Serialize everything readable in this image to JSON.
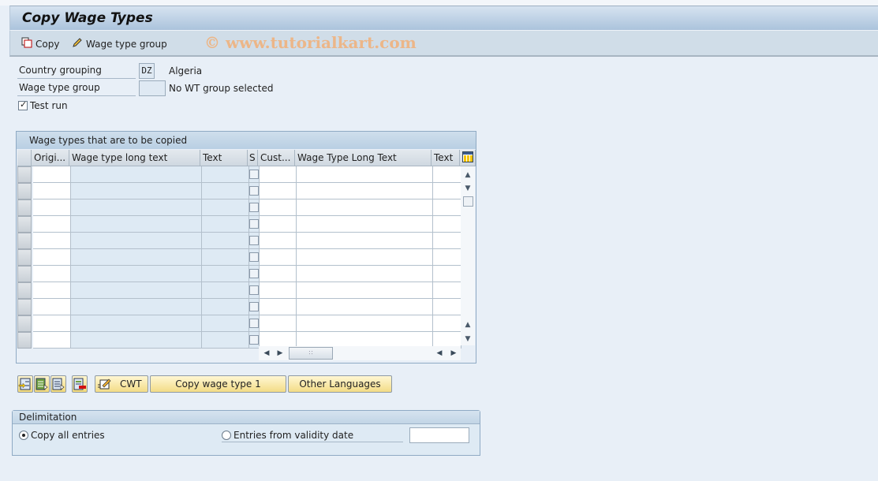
{
  "window": {
    "title": "Copy Wage Types"
  },
  "toolbar": {
    "copy_label": "Copy",
    "copy_icon": "copy-icon",
    "wage_type_group_label": "Wage type group",
    "wage_type_group_icon": "pencil-icon",
    "watermark": "© www.tutorialkart.com"
  },
  "selection": {
    "country_grouping": {
      "label": "Country grouping",
      "value": "DZ",
      "description": "Algeria"
    },
    "wage_type_group": {
      "label": "Wage type group",
      "value": "",
      "description": "No WT group selected"
    },
    "test_run": {
      "label": "Test run",
      "checked": true
    }
  },
  "grid": {
    "caption": "Wage types that are to be copied",
    "columns": [
      "Origi...",
      "Wage type long text",
      "Text",
      "S",
      "Cust...",
      "Wage Type Long Text",
      "Text"
    ],
    "row_count": 11,
    "rows": []
  },
  "actions": {
    "icon_buttons": [
      "insert-row-icon",
      "select-all-icon",
      "deselect-icon",
      "delete-row-icon"
    ],
    "cwt_label": "CWT",
    "copy_wage_type_label": "Copy wage type 1",
    "other_languages_label": "Other Languages"
  },
  "delimitation": {
    "title": "Delimitation",
    "copy_all_label": "Copy all entries",
    "copy_all_selected": true,
    "from_validity_label": "Entries from validity date",
    "from_validity_selected": false,
    "validity_date_value": ""
  }
}
